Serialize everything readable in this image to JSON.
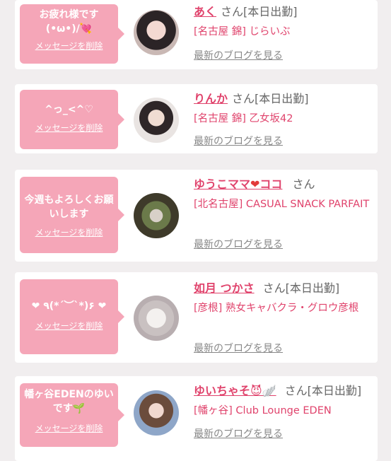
{
  "common": {
    "delete_label": "メッセージを削除",
    "blog_label": "最新のブログを見る",
    "san": "さん"
  },
  "cards": [
    {
      "message": "お疲れ様です(•ω•)/💘",
      "name": "あく",
      "status": "[本日出勤]",
      "store": "[名古屋 錦] じらいぶ"
    },
    {
      "message": "^っ_<^♡",
      "name": "りんか",
      "status": "[本日出勤]",
      "store": "[名古屋 錦] 乙女坂42"
    },
    {
      "message": "今週もよろしくお願いします",
      "name": "ゆうこママ",
      "name_heart": "❤",
      "name_suffix": "ココ",
      "status": "",
      "store": "[北名古屋] CASUAL SNACK PARFAIT"
    },
    {
      "message": "❤ ٩(*´︶`*)۶ ❤",
      "name": "如月 つかさ",
      "status": "[本日出勤]",
      "store": "[彦根] 熟女キャバクラ・グロウ彦根"
    },
    {
      "message": "幡ヶ谷EDENのゆいです🌱",
      "name": "ゆいちゃそ😈🪽",
      "status": "[本日出勤]",
      "store": "[幡ヶ谷] Club Lounge EDEN"
    }
  ],
  "colors": {
    "accent": "#e0436c",
    "bubble": "#f5a6b8",
    "background": "#f1eeef"
  }
}
